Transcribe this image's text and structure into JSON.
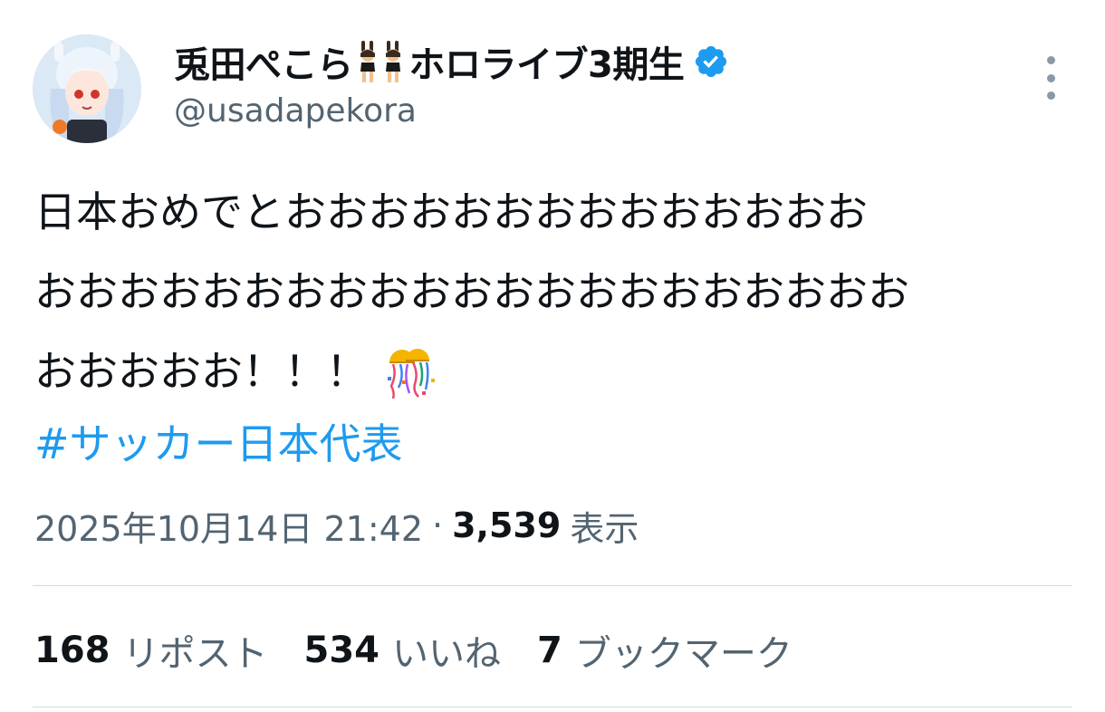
{
  "user": {
    "display_name": "兎田ぺこら",
    "display_name_suffix": "ホロライブ3期生",
    "handle": "@usadapekora",
    "verified_color": "#1d9bf0"
  },
  "tweet": {
    "lines": [
      "日本おめでとおおおおおおおおおおおおおお",
      "おおおおおおおおおおおおおおおおおおおおお",
      "おおおおお！！！"
    ],
    "hashtag": "#サッカー日本代表",
    "emoji": "confetti-ball-icon"
  },
  "meta": {
    "timestamp": "2025年10月14日 21:42",
    "separator": "·",
    "views_count": "3,539",
    "views_label": "表示"
  },
  "stats": {
    "reposts_count": "168",
    "reposts_label": "リポスト",
    "likes_count": "534",
    "likes_label": "いいね",
    "bookmarks_count": "7",
    "bookmarks_label": "ブックマーク"
  },
  "colors": {
    "text": "#0f1419",
    "secondary": "#536471",
    "link": "#1d9bf0",
    "divider": "#cfd9de"
  }
}
